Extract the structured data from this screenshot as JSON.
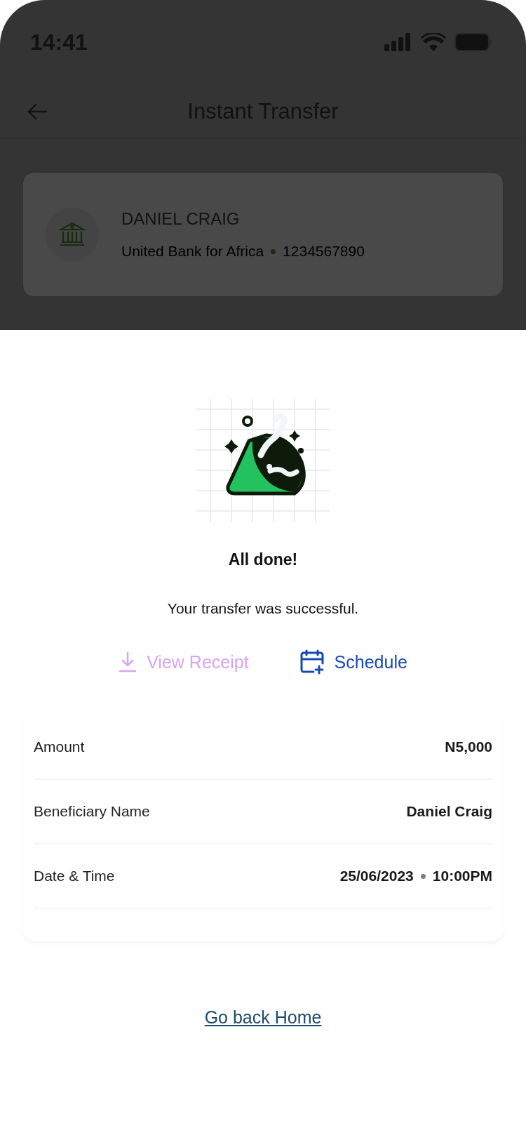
{
  "status_bar": {
    "time": "14:41"
  },
  "header": {
    "title": "Instant Transfer"
  },
  "beneficiary": {
    "name": "DANIEL CRAIG",
    "bank": "United Bank for Africa",
    "account": "1234567890"
  },
  "result": {
    "title": "All done!",
    "message": "Your transfer was successful."
  },
  "actions": [
    {
      "kind": "download",
      "label": "View Receipt",
      "disabled": true
    },
    {
      "kind": "schedule",
      "label": "Schedule",
      "disabled": false
    }
  ],
  "details": [
    {
      "label": "Amount",
      "values": [
        "N5,000"
      ]
    },
    {
      "label": "Beneficiary Name",
      "values": [
        "Daniel Craig"
      ]
    },
    {
      "label": "Date & Time",
      "values": [
        "25/06/2023",
        "10:00PM"
      ]
    }
  ],
  "home_link": "Go back Home"
}
